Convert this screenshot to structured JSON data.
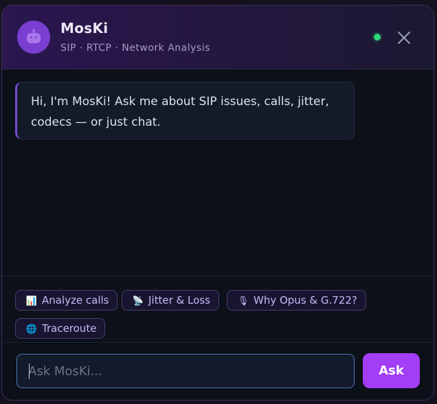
{
  "header": {
    "title": "MosKi",
    "subtitle": "SIP · RTCP · Network Analysis",
    "avatar_icon": "robot-icon",
    "status_color": "#2fd576",
    "close_icon": "close-icon"
  },
  "messages": [
    {
      "role": "assistant",
      "text": "Hi, I'm MosKi! Ask me about SIP issues, calls, jitter, codecs — or just chat."
    }
  ],
  "suggestions": [
    {
      "icon": "📊",
      "icon_name": "bar-chart-icon",
      "label": "Analyze calls"
    },
    {
      "icon": "📡",
      "icon_name": "satellite-icon",
      "label": "Jitter & Loss"
    },
    {
      "icon": "🎙",
      "icon_name": "microphone-icon",
      "label": "Why Opus & G.722?"
    },
    {
      "icon": "🌐",
      "icon_name": "globe-icon",
      "label": "Traceroute"
    }
  ],
  "composer": {
    "placeholder": "Ask MosKi...",
    "value": "",
    "send_label": "Ask"
  },
  "colors": {
    "accent": "#a23ef6",
    "header_bg": "#2b1650",
    "panel_bg": "#0c1019",
    "chip_text": "#c8b8f5",
    "input_border": "#4d78b8"
  }
}
